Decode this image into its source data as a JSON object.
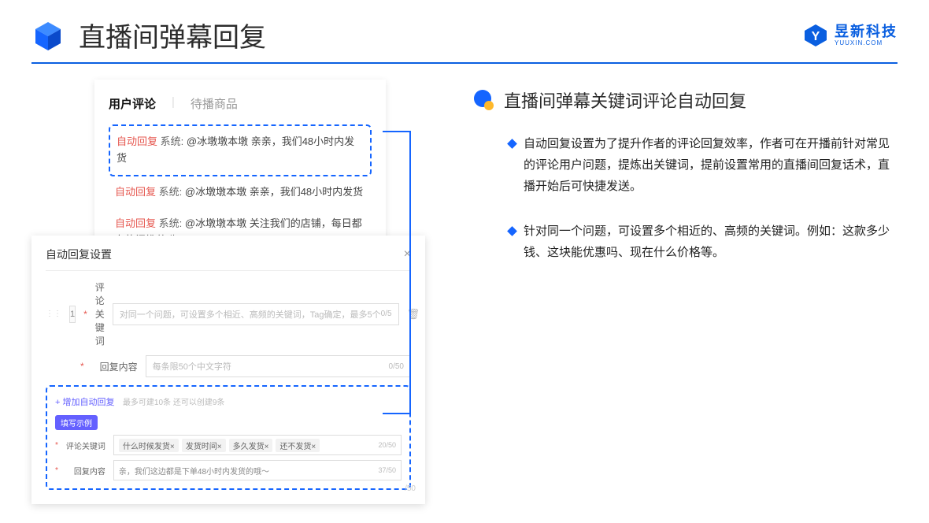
{
  "header": {
    "title": "直播间弹幕回复",
    "logo_cn": "昱新科技",
    "logo_en": "YUUXIN.COM"
  },
  "comments_panel": {
    "tab_active": "用户评论",
    "tab_other": "待播商品",
    "reply_tag": "自动回复",
    "system_tag": "系统:",
    "c1": "@冰墩墩本墩 亲亲，我们48小时内发货",
    "c2": "@冰墩墩本墩 亲亲，我们48小时内发货",
    "c3": "@冰墩墩本墩 关注我们的店铺，每日都有热门推荐呦～"
  },
  "settings_panel": {
    "title": "自动回复设置",
    "index": "1",
    "label_keyword": "评论关键词",
    "ph_keyword": "对同一个问题，可设置多个相近、高频的关键词，Tag确定，最多5个",
    "count_keyword": "0/5",
    "label_reply": "回复内容",
    "ph_reply": "每条限50个中文字符",
    "count_reply": "0/50",
    "add_link": "+ 增加自动回复",
    "add_sub": "最多可建10条 还可以创建9条",
    "badge": "填写示例",
    "ex_label_kw": "评论关键词",
    "ex_label_rp": "回复内容",
    "chip1": "什么时候发货×",
    "chip2": "发货时间×",
    "chip3": "多久发货×",
    "chip4": "还不发货×",
    "ex_kw_count": "20/50",
    "ex_reply": "亲，我们这边都是下单48小时内发货的哦～",
    "ex_rp_count": "37/50",
    "scroll_count": "/50"
  },
  "right": {
    "subtitle": "直播间弹幕关键词评论自动回复",
    "b1": "自动回复设置为了提升作者的评论回复效率，作者可在开播前针对常见的评论用户问题，提炼出关键词，提前设置常用的直播间回复话术，直播开始后可快捷发送。",
    "b2": "针对同一个问题，可设置多个相近的、高频的关键词。例如：这款多少钱、这块能优惠吗、现在什么价格等。"
  }
}
